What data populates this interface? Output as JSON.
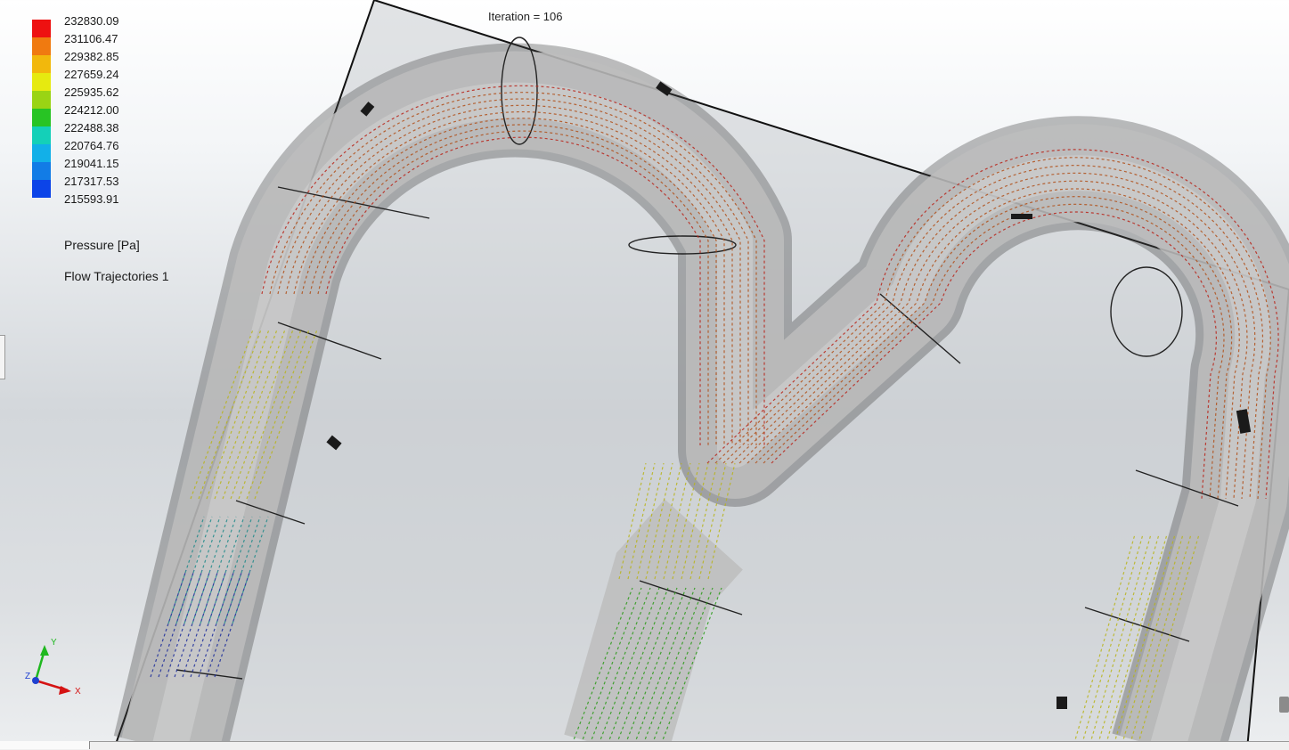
{
  "legend": {
    "values": [
      "232830.09",
      "231106.47",
      "229382.85",
      "227659.24",
      "225935.62",
      "224212.00",
      "222488.38",
      "220764.76",
      "219041.15",
      "217317.53",
      "215593.91"
    ],
    "colors": [
      "#ee1111",
      "#f07a10",
      "#f2b80c",
      "#e6ea10",
      "#9ad414",
      "#28c424",
      "#14d0b8",
      "#12b0e8",
      "#127ce6",
      "#0c44e8"
    ],
    "title": "Pressure [Pa]",
    "plot_name": "Flow Trajectories 1"
  },
  "header": {
    "iteration": "Iteration = 106"
  },
  "triad": {
    "y_label": "Y",
    "x_label": "X",
    "z_label": "Z"
  },
  "colors": {
    "trace_red": "#b8241a",
    "trace_orange": "#b0501a",
    "trace_yellow": "#b8b41a",
    "trace_green": "#2a9a18",
    "trace_teal": "#1f8a8a",
    "trace_blue": "#1a2a9a"
  }
}
